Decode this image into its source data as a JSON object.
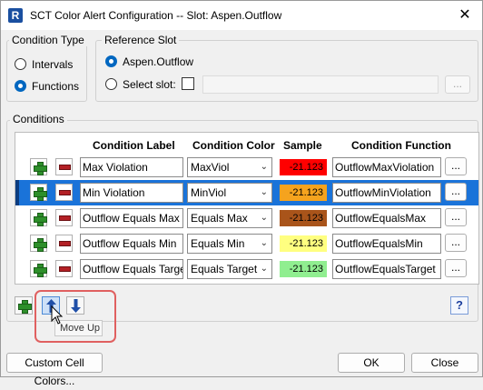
{
  "window": {
    "title": "SCT Color Alert Configuration -- Slot: Aspen.Outflow",
    "app_icon": "R",
    "close_glyph": "✕"
  },
  "condition_type": {
    "title": "Condition Type",
    "options": [
      {
        "label": "Intervals",
        "checked": false
      },
      {
        "label": "Functions",
        "checked": true
      }
    ]
  },
  "reference_slot": {
    "title": "Reference Slot",
    "slot_option": {
      "label": "Aspen.Outflow",
      "checked": true
    },
    "select_option": {
      "label": "Select slot:",
      "checked": false
    },
    "browse_label": "..."
  },
  "conditions": {
    "title": "Conditions",
    "headers": {
      "label": "Condition Label",
      "color": "Condition Color",
      "sample": "Sample",
      "function": "Condition Function"
    },
    "rows": [
      {
        "label": "Max Violation",
        "color": "MaxViol",
        "sample": "-21.123",
        "sample_bg": "#ff0000",
        "function": "OutflowMaxViolation",
        "selected": false
      },
      {
        "label": "Min Violation",
        "color": "MinViol",
        "sample": "-21.123",
        "sample_bg": "#f5a31e",
        "function": "OutflowMinViolation",
        "selected": true
      },
      {
        "label": "Outflow Equals Max",
        "color": "Equals Max",
        "sample": "-21.123",
        "sample_bg": "#a9541a",
        "function": "OutflowEqualsMax",
        "selected": false
      },
      {
        "label": "Outflow Equals Min",
        "color": "Equals Min",
        "sample": "-21.123",
        "sample_bg": "#ffff80",
        "function": "OutflowEqualsMin",
        "selected": false
      },
      {
        "label": "Outflow Equals Target",
        "color": "Equals Target",
        "sample": "-21.123",
        "sample_bg": "#90ee90",
        "function": "OutflowEqualsTarget",
        "selected": false
      }
    ],
    "dots_label": "..."
  },
  "toolbar": {
    "tooltip": "Move Up",
    "help_label": "?"
  },
  "buttons": {
    "custom_colors": "Custom Cell Colors...",
    "ok": "OK",
    "close": "Close"
  }
}
